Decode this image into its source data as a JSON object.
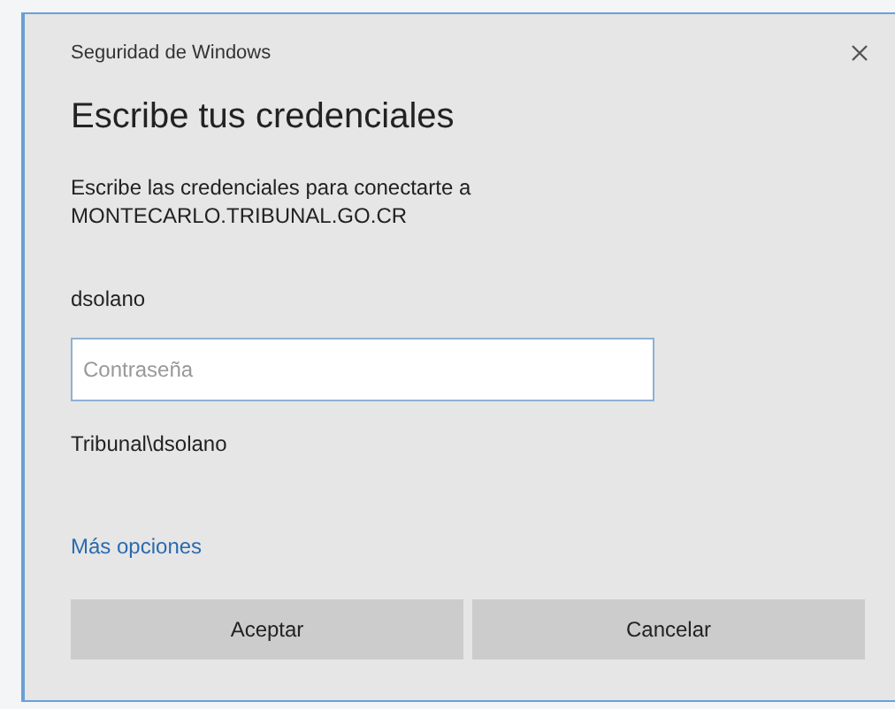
{
  "window": {
    "title": "Seguridad de Windows"
  },
  "heading": "Escribe tus credenciales",
  "prompt": [
    "Escribe las credenciales para conectarte a",
    "MONTECARLO.TRIBUNAL.GO.CR"
  ],
  "username": "dsolano",
  "password": {
    "placeholder": "Contraseña"
  },
  "domain_user": "Tribunal\\dsolano",
  "more_options_link": "Más opciones",
  "buttons": [
    {
      "label": "Aceptar"
    },
    {
      "label": "Cancelar"
    }
  ]
}
